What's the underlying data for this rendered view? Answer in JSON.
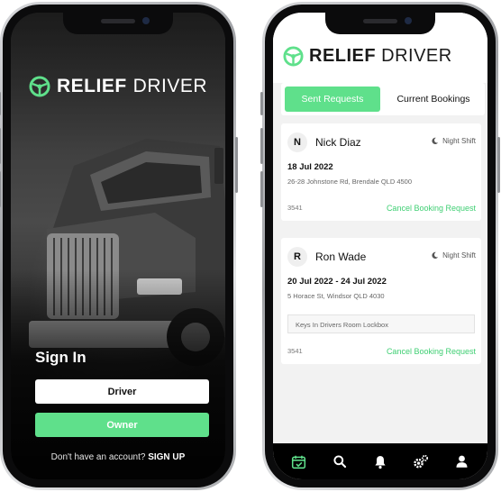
{
  "brand": {
    "bold": "RELIEF",
    "light": "DRIVER",
    "accent": "#5fe08b"
  },
  "login": {
    "heading": "Sign In",
    "driver_label": "Driver",
    "owner_label": "Owner",
    "signup_prompt": "Don't have an account?",
    "signup_link": "SIGN UP"
  },
  "app": {
    "tabs": [
      {
        "label": "Sent Requests",
        "active": true
      },
      {
        "label": "Current Bookings",
        "active": false
      }
    ],
    "requests": [
      {
        "initial": "N",
        "name": "Nick Diaz",
        "shift": "Night Shift",
        "date": "18 Jul 2022",
        "address": "26-28 Johnstone Rd, Brendale QLD 4500",
        "note": "",
        "ref": "3541",
        "action": "Cancel Booking Request"
      },
      {
        "initial": "R",
        "name": "Ron Wade",
        "shift": "Night Shift",
        "date": "20 Jul 2022 - 24 Jul 2022",
        "address": "5 Horace St, Windsor QLD 4030",
        "note": "Keys In Drivers Room Lockbox",
        "ref": "3541",
        "action": "Cancel Booking Request"
      }
    ],
    "nav": [
      {
        "icon": "calendar-icon",
        "active": true
      },
      {
        "icon": "search-icon",
        "active": false
      },
      {
        "icon": "bell-icon",
        "active": false
      },
      {
        "icon": "gears-icon",
        "active": false
      },
      {
        "icon": "user-icon",
        "active": false
      }
    ]
  }
}
